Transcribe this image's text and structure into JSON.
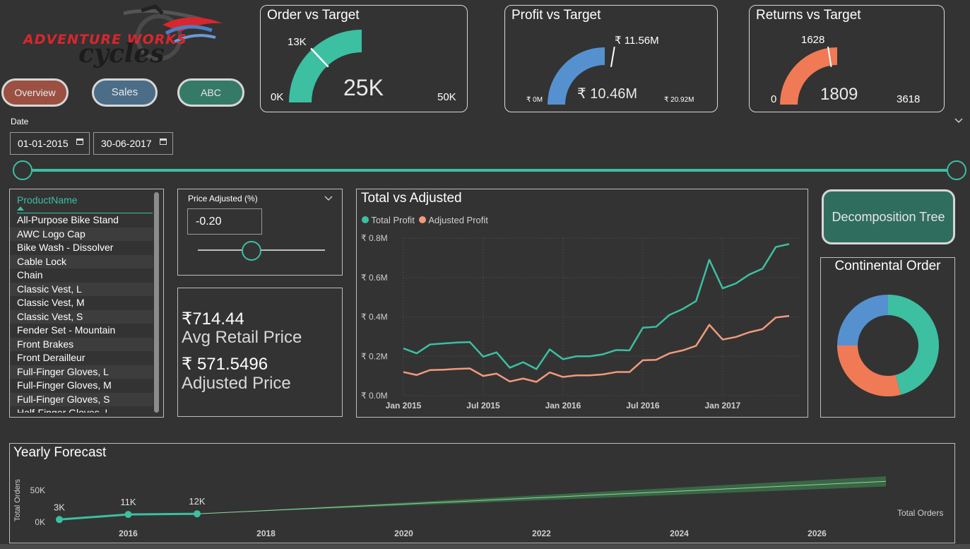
{
  "brand": {
    "line1": "ADVENTURE WORKS",
    "line2": "cycles"
  },
  "nav": {
    "overview": "Overview",
    "sales": "Sales",
    "abc": "ABC"
  },
  "colors": {
    "teal": "#3dbfa2",
    "blue": "#5591cf",
    "orange": "#f07a55",
    "salmon": "#f29a7d",
    "nav_overview": "#9b5042",
    "nav_sales": "#4b6d88",
    "nav_abc": "#357a66",
    "decomp": "#2f6e5e"
  },
  "gauges": {
    "order": {
      "title": "Order vs Target",
      "value": "25K",
      "target": "13K",
      "min": "0K",
      "max": "50K",
      "fraction": 0.5,
      "target_fraction": 0.26
    },
    "profit": {
      "title": "Profit vs Target",
      "value": "₹ 10.46M",
      "target": "₹ 11.56M",
      "min": "₹ 0M",
      "max": "₹ 20.92M",
      "fraction": 0.5,
      "target_fraction": 0.553
    },
    "returns": {
      "title": "Returns vs Target",
      "value": "1809",
      "target": "1628",
      "min": "0",
      "max": "3618",
      "fraction": 0.5,
      "target_fraction": 0.45
    }
  },
  "date_filter": {
    "label": "Date",
    "start": "01-01-2015",
    "end": "30-06-2017",
    "chevron": "chevron-down-icon"
  },
  "product_slicer": {
    "header": "ProductName",
    "items": [
      "All-Purpose Bike Stand",
      "AWC Logo Cap",
      "Bike Wash - Dissolver",
      "Cable Lock",
      "Chain",
      "Classic Vest, L",
      "Classic Vest, M",
      "Classic Vest, S",
      "Fender Set - Mountain",
      "Front Brakes",
      "Front Derailleur",
      "Full-Finger Gloves, L",
      "Full-Finger Gloves, M",
      "Full-Finger Gloves, S",
      "Half-Finger Gloves, L"
    ]
  },
  "price_adjusted": {
    "label": "Price Adjusted (%)",
    "value": "-0.20"
  },
  "kpi": {
    "avg_retail_value": "₹714.44",
    "avg_retail_label": "Avg Retail Price",
    "adjusted_value": "₹ 571.5496",
    "adjusted_label": "Adjusted Price"
  },
  "decomposition": {
    "label": "Decomposition Tree"
  },
  "chart_data": [
    {
      "type": "line",
      "title": "Total vs Adjusted",
      "x_tick_labels": [
        "Jan 2015",
        "Jul 2015",
        "Jan 2016",
        "Jul 2016",
        "Jan 2017"
      ],
      "y_tick_labels": [
        "₹ 0.0M",
        "₹ 0.2M",
        "₹ 0.4M",
        "₹ 0.6M",
        "₹ 0.8M"
      ],
      "ylim": [
        0,
        0.8
      ],
      "x": [
        "2015-01",
        "2015-02",
        "2015-03",
        "2015-04",
        "2015-05",
        "2015-06",
        "2015-07",
        "2015-08",
        "2015-09",
        "2015-10",
        "2015-11",
        "2015-12",
        "2016-01",
        "2016-02",
        "2016-03",
        "2016-04",
        "2016-05",
        "2016-06",
        "2016-07",
        "2016-08",
        "2016-09",
        "2016-10",
        "2016-11",
        "2016-12",
        "2017-01",
        "2017-02",
        "2017-03",
        "2017-04",
        "2017-05",
        "2017-06"
      ],
      "series": [
        {
          "name": "Total Profit",
          "color": "#3dbfa2",
          "values": [
            0.24,
            0.215,
            0.26,
            0.265,
            0.27,
            0.272,
            0.198,
            0.22,
            0.142,
            0.17,
            0.135,
            0.235,
            0.185,
            0.2,
            0.2,
            0.21,
            0.232,
            0.23,
            0.345,
            0.35,
            0.41,
            0.44,
            0.48,
            0.69,
            0.545,
            0.57,
            0.615,
            0.645,
            0.755,
            0.77
          ]
        },
        {
          "name": "Adjusted Profit",
          "color": "#f29a7d",
          "values": [
            0.12,
            0.105,
            0.13,
            0.132,
            0.136,
            0.138,
            0.1,
            0.112,
            0.072,
            0.087,
            0.07,
            0.118,
            0.095,
            0.103,
            0.103,
            0.108,
            0.12,
            0.12,
            0.18,
            0.182,
            0.215,
            0.23,
            0.253,
            0.36,
            0.285,
            0.298,
            0.322,
            0.338,
            0.397,
            0.405
          ]
        }
      ]
    },
    {
      "type": "pie",
      "title": "Continental Order",
      "slices": [
        {
          "value": 0.46,
          "color": "#3dbfa2"
        },
        {
          "value": 0.29,
          "color": "#f07a55"
        },
        {
          "value": 0.25,
          "color": "#5591cf"
        }
      ]
    },
    {
      "type": "line",
      "title": "Yearly Forecast",
      "ylabel": "Total Orders",
      "legend": "Total Orders",
      "x_tick_labels": [
        "2016",
        "2018",
        "2020",
        "2022",
        "2024",
        "2026"
      ],
      "y_tick_labels": [
        "0K",
        "50K"
      ],
      "series": [
        {
          "name": "Total Orders",
          "x": [
            2015,
            2016,
            2017
          ],
          "values": [
            3,
            11,
            12
          ],
          "labels": [
            "3K",
            "11K",
            "12K"
          ]
        }
      ],
      "forecast": {
        "x": [
          2017,
          2027
        ],
        "values": [
          12,
          63
        ],
        "band": 8
      }
    }
  ]
}
